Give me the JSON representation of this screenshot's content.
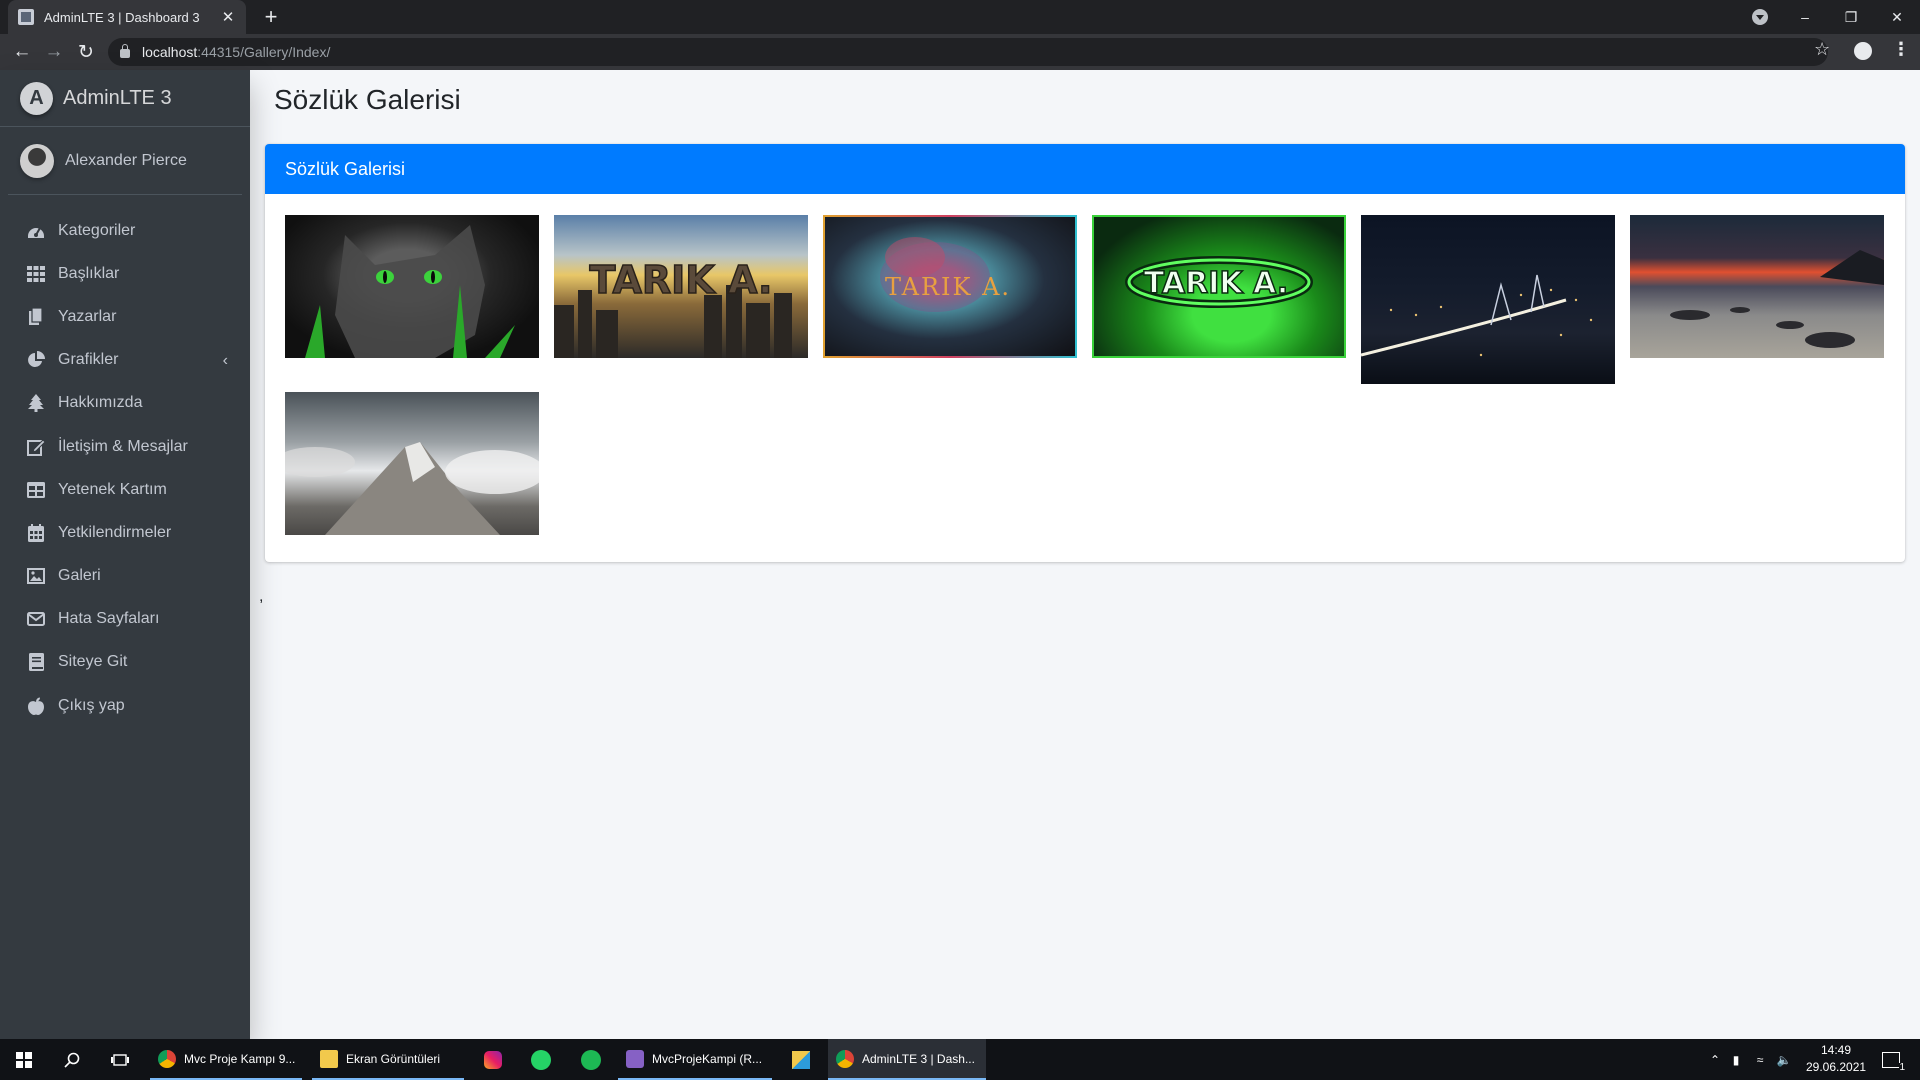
{
  "browser": {
    "tab_title": "AdminLTE 3 | Dashboard 3",
    "tab_close": "✕",
    "new_tab": "+",
    "url_host": "localhost",
    "url_rest": ":44315/Gallery/Index/"
  },
  "sidebar": {
    "brand": "AdminLTE 3",
    "brand_logo": "A",
    "user_name": "Alexander Pierce",
    "items": [
      {
        "label": "Kategoriler",
        "icon": "tachometer-icon"
      },
      {
        "label": "Başlıklar",
        "icon": "grid-icon"
      },
      {
        "label": "Yazarlar",
        "icon": "copy-icon"
      },
      {
        "label": "Grafikler",
        "icon": "pie-chart-icon",
        "has_submenu": true
      },
      {
        "label": "Hakkımızda",
        "icon": "tree-icon"
      },
      {
        "label": "İletişim & Mesajlar",
        "icon": "edit-icon"
      },
      {
        "label": "Yetenek Kartım",
        "icon": "table-icon"
      },
      {
        "label": "Yetkilendirmeler",
        "icon": "calendar-icon"
      },
      {
        "label": "Galeri",
        "icon": "image-icon"
      },
      {
        "label": "Hata Sayfaları",
        "icon": "envelope-icon"
      },
      {
        "label": "Siteye Git",
        "icon": "book-icon"
      },
      {
        "label": "Çıkış yap",
        "icon": "apple-icon"
      }
    ]
  },
  "main": {
    "page_title": "Sözlük Galerisi",
    "card_title": "Sözlük Galerisi",
    "stray_text": ",",
    "thumbnails": [
      {
        "name": "cat",
        "text": ""
      },
      {
        "name": "city-tarik",
        "text": "TARIK A."
      },
      {
        "name": "smoke-tarik",
        "text": "TARIK A."
      },
      {
        "name": "green-tarik",
        "text": "TARIK A."
      },
      {
        "name": "night-bridge",
        "text": ""
      },
      {
        "name": "beach-sunset",
        "text": ""
      },
      {
        "name": "mountain",
        "text": ""
      }
    ]
  },
  "taskbar": {
    "apps": [
      {
        "label": "Mvc Proje Kampı 9...",
        "icon": "chrome-icon"
      },
      {
        "label": "Ekran Görüntüleri",
        "icon": "folder-icon"
      },
      {
        "label": "MvcProjeKampi (R...",
        "icon": "visual-studio-icon"
      },
      {
        "label": "AdminLTE 3 | Dash...",
        "icon": "chrome-icon"
      }
    ],
    "time": "14:49",
    "date": "29.06.2021",
    "notification_count": "1"
  },
  "colors": {
    "sidebar": "#343a40",
    "accent": "#007bff",
    "content_bg": "#f4f6f9"
  }
}
